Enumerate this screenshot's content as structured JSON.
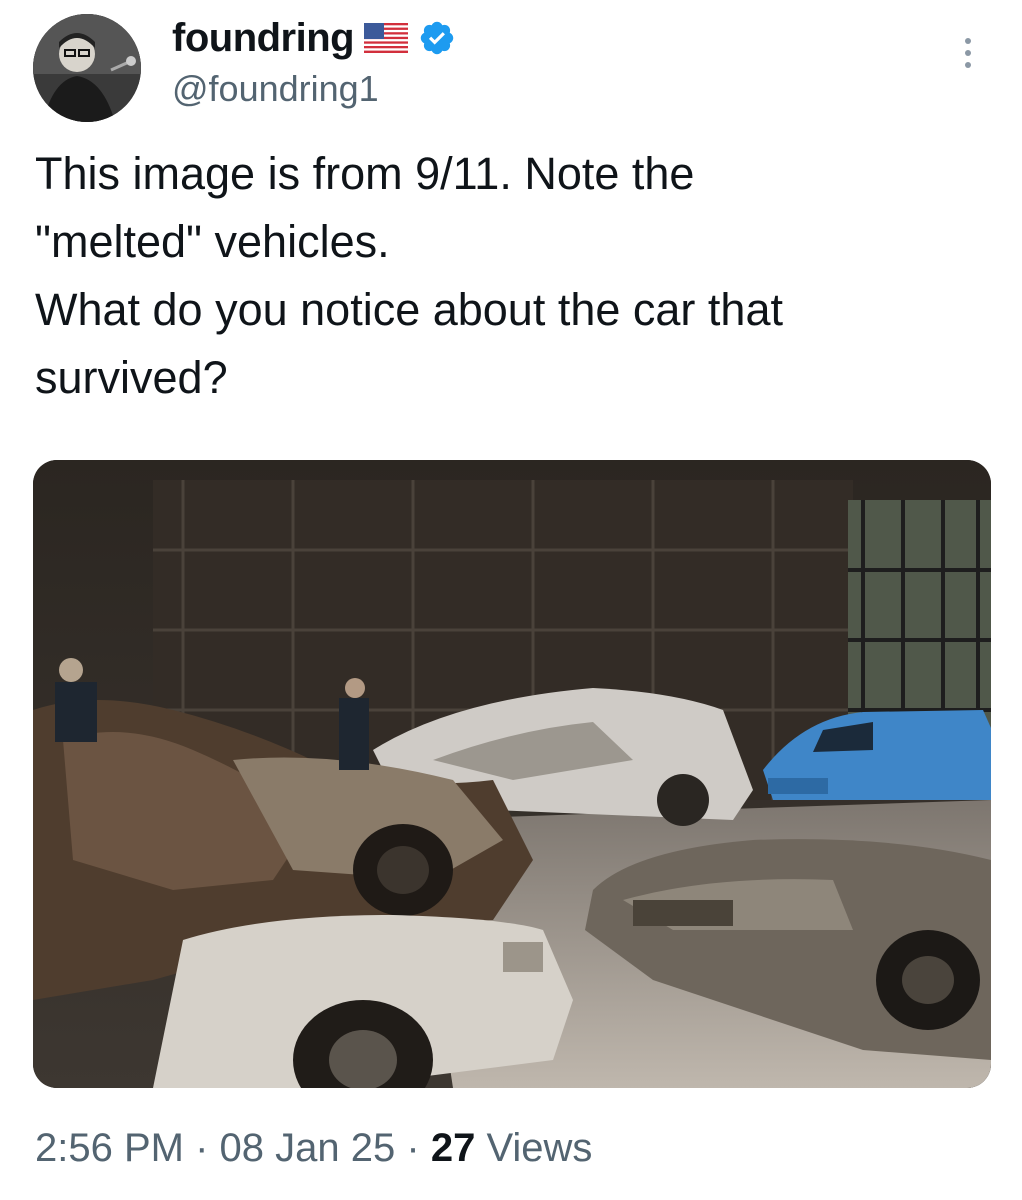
{
  "author": {
    "display_name": "foundring",
    "handle": "@foundring1",
    "flag_icon": "us-flag-icon",
    "verified_icon": "verified-badge-icon",
    "verified_color": "#1d9bf0"
  },
  "tweet": {
    "text_lines": [
      "This image is from 9/11. Note the",
      "\"melted\" vehicles.",
      "What do you notice about the car that",
      "survived?"
    ]
  },
  "meta": {
    "time": "2:56 PM",
    "separator": "·",
    "date": "08 Jan 25",
    "views_count": "27",
    "views_label": "Views"
  },
  "icons": {
    "more": "more-options-icon"
  },
  "colors": {
    "text_primary": "#0f1419",
    "text_secondary": "#536471",
    "accent": "#1d9bf0"
  }
}
